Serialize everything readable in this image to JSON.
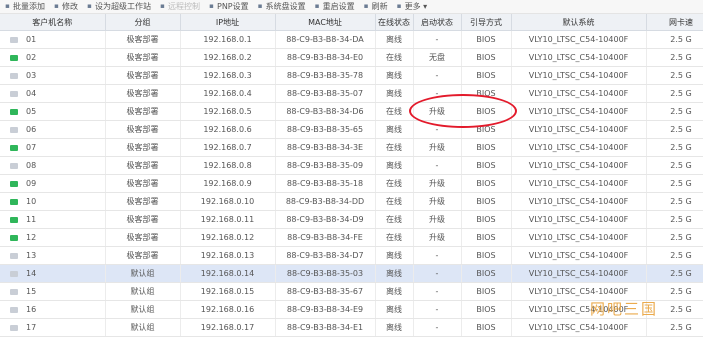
{
  "toolbar": [
    {
      "icon": "plus-icon",
      "label": "批量添加",
      "disabled": false
    },
    {
      "icon": "pencil-icon",
      "label": "修改",
      "disabled": false
    },
    {
      "icon": "workstation-icon",
      "label": "设为超级工作站",
      "disabled": false
    },
    {
      "icon": "terminal-icon",
      "label": "远程控制",
      "disabled": true
    },
    {
      "icon": "pnp-icon",
      "label": "PNP设置",
      "disabled": false
    },
    {
      "icon": "system-settings-icon",
      "label": "系统盘设置",
      "disabled": false
    },
    {
      "icon": "power-icon",
      "label": "重启设置",
      "disabled": false
    },
    {
      "icon": "refresh-icon",
      "label": "刷新",
      "disabled": false
    },
    {
      "icon": "more-icon",
      "label": "更多 ▾",
      "disabled": false
    }
  ],
  "columns": [
    "客户机名称",
    "分组",
    "IP地址",
    "MAC地址",
    "在线状态",
    "启动状态",
    "引导方式",
    "默认系统",
    "网卡速"
  ],
  "rows": [
    {
      "name": "01",
      "group": "极客部署",
      "ip": "192.168.0.1",
      "mac": "88-C9-B3-B8-34-DA",
      "online": "离线",
      "boot": "-",
      "bootmode": "BIOS",
      "os": "VLY10_LTSC_C54-10400F",
      "speed": "2.5 G",
      "on": false
    },
    {
      "name": "02",
      "group": "极客部署",
      "ip": "192.168.0.2",
      "mac": "88-C9-B3-B8-34-E0",
      "online": "在线",
      "boot": "无盘",
      "bootmode": "BIOS",
      "os": "VLY10_LTSC_C54-10400F",
      "speed": "2.5 G",
      "on": true
    },
    {
      "name": "03",
      "group": "极客部署",
      "ip": "192.168.0.3",
      "mac": "88-C9-B3-B8-35-78",
      "online": "离线",
      "boot": "-",
      "bootmode": "BIOS",
      "os": "VLY10_LTSC_C54-10400F",
      "speed": "2.5 G",
      "on": false
    },
    {
      "name": "04",
      "group": "极客部署",
      "ip": "192.168.0.4",
      "mac": "88-C9-B3-B8-35-07",
      "online": "离线",
      "boot": "-",
      "bootmode": "BIOS",
      "os": "VLY10_LTSC_C54-10400F",
      "speed": "2.5 G",
      "on": false
    },
    {
      "name": "05",
      "group": "极客部署",
      "ip": "192.168.0.5",
      "mac": "88-C9-B3-B8-34-D6",
      "online": "在线",
      "boot": "升级",
      "bootmode": "BIOS",
      "os": "VLY10_LTSC_C54-10400F",
      "speed": "2.5 G",
      "on": true
    },
    {
      "name": "06",
      "group": "极客部署",
      "ip": "192.168.0.6",
      "mac": "88-C9-B3-B8-35-65",
      "online": "离线",
      "boot": "-",
      "bootmode": "BIOS",
      "os": "VLY10_LTSC_C54-10400F",
      "speed": "2.5 G",
      "on": false
    },
    {
      "name": "07",
      "group": "极客部署",
      "ip": "192.168.0.7",
      "mac": "88-C9-B3-B8-34-3E",
      "online": "在线",
      "boot": "升级",
      "bootmode": "BIOS",
      "os": "VLY10_LTSC_C54-10400F",
      "speed": "2.5 G",
      "on": true
    },
    {
      "name": "08",
      "group": "极客部署",
      "ip": "192.168.0.8",
      "mac": "88-C9-B3-B8-35-09",
      "online": "离线",
      "boot": "-",
      "bootmode": "BIOS",
      "os": "VLY10_LTSC_C54-10400F",
      "speed": "2.5 G",
      "on": false
    },
    {
      "name": "09",
      "group": "极客部署",
      "ip": "192.168.0.9",
      "mac": "88-C9-B3-B8-35-18",
      "online": "在线",
      "boot": "升级",
      "bootmode": "BIOS",
      "os": "VLY10_LTSC_C54-10400F",
      "speed": "2.5 G",
      "on": true
    },
    {
      "name": "10",
      "group": "极客部署",
      "ip": "192.168.0.10",
      "mac": "88-C9-B3-B8-34-DD",
      "online": "在线",
      "boot": "升级",
      "bootmode": "BIOS",
      "os": "VLY10_LTSC_C54-10400F",
      "speed": "2.5 G",
      "on": true
    },
    {
      "name": "11",
      "group": "极客部署",
      "ip": "192.168.0.11",
      "mac": "88-C9-B3-B8-34-D9",
      "online": "在线",
      "boot": "升级",
      "bootmode": "BIOS",
      "os": "VLY10_LTSC_C54-10400F",
      "speed": "2.5 G",
      "on": true
    },
    {
      "name": "12",
      "group": "极客部署",
      "ip": "192.168.0.12",
      "mac": "88-C9-B3-B8-34-FE",
      "online": "在线",
      "boot": "升级",
      "bootmode": "BIOS",
      "os": "VLY10_LTSC_C54-10400F",
      "speed": "2.5 G",
      "on": true
    },
    {
      "name": "13",
      "group": "极客部署",
      "ip": "192.168.0.13",
      "mac": "88-C9-B3-B8-34-D7",
      "online": "离线",
      "boot": "-",
      "bootmode": "BIOS",
      "os": "VLY10_LTSC_C54-10400F",
      "speed": "2.5 G",
      "on": false
    },
    {
      "name": "14",
      "group": "默认组",
      "ip": "192.168.0.14",
      "mac": "88-C9-B3-B8-35-03",
      "online": "离线",
      "boot": "-",
      "bootmode": "BIOS",
      "os": "VLY10_LTSC_C54-10400F",
      "speed": "2.5 G",
      "on": false,
      "selected": true
    },
    {
      "name": "15",
      "group": "默认组",
      "ip": "192.168.0.15",
      "mac": "88-C9-B3-B8-35-67",
      "online": "离线",
      "boot": "-",
      "bootmode": "BIOS",
      "os": "VLY10_LTSC_C54-10400F",
      "speed": "2.5 G",
      "on": false
    },
    {
      "name": "16",
      "group": "默认组",
      "ip": "192.168.0.16",
      "mac": "88-C9-B3-B8-34-E9",
      "online": "离线",
      "boot": "-",
      "bootmode": "BIOS",
      "os": "VLY10_LTSC_C54-10400F",
      "speed": "2.5 G",
      "on": false
    },
    {
      "name": "17",
      "group": "默认组",
      "ip": "192.168.0.17",
      "mac": "88-C9-B3-B8-34-E1",
      "online": "离线",
      "boot": "-",
      "bootmode": "BIOS",
      "os": "VLY10_LTSC_C54-10400F",
      "speed": "2.5 G",
      "on": false
    }
  ],
  "watermark": "网吧三国",
  "colors": {
    "online": "#2fb65a",
    "offline": "#c9ced6",
    "callout": "#e31a2b",
    "selected_row": "#dde6f6"
  }
}
